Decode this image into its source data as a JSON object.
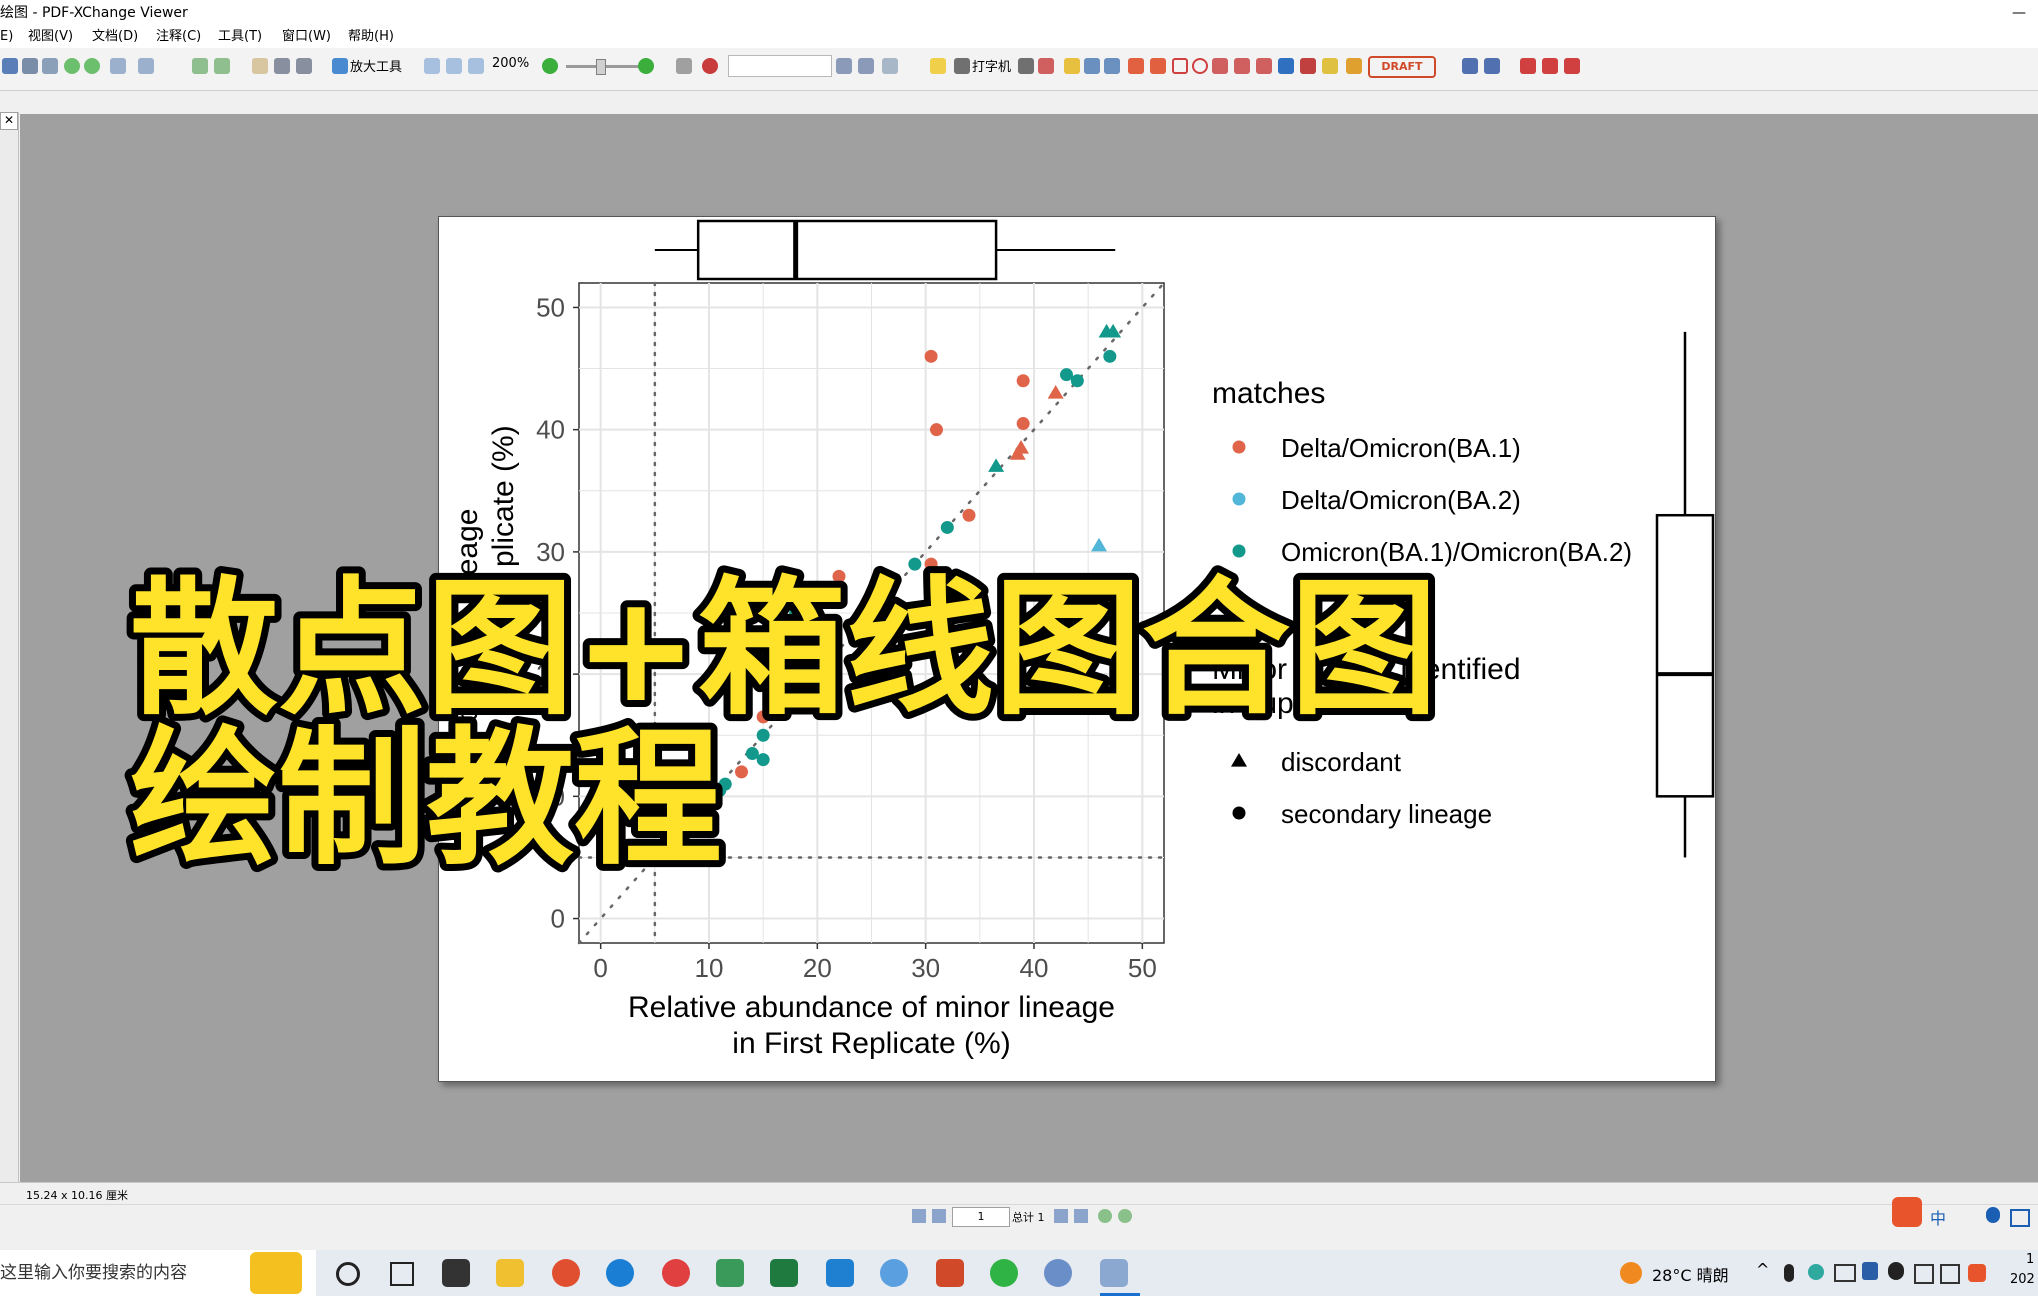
{
  "window": {
    "title": "绘图 - PDF-XChange Viewer",
    "minimize_glyph": "—"
  },
  "menu": [
    "E)",
    "视图(V)",
    "文档(D)",
    "注释(C)",
    "工具(T)",
    "窗口(W)",
    "帮助(H)"
  ],
  "toolbar": {
    "zoom_tool_label": "放大工具",
    "zoom_value": "200%",
    "typewriter_label": "打字机",
    "stamp_label": "DRAFT"
  },
  "panel": {
    "close_glyph": "✕"
  },
  "status": {
    "page_size": "15.24 x 10.16 厘米"
  },
  "nav": {
    "page_current": "1",
    "page_total": "总计 1"
  },
  "overlay": {
    "line1": "散点图+箱线图合图",
    "line2": "绘制教程"
  },
  "taskbar": {
    "search_placeholder": "这里输入你要搜索的内容",
    "weather": "28°C 晴朗",
    "ime_label": "中",
    "clock_time": "1",
    "clock_date": "202"
  },
  "chart_data": {
    "type": "scatter",
    "xlabel": "Relative abundance of minor lineage\nin First Replicate (%)",
    "ylabel": "Relative abundance of minor lineage\nin Second Replicate (%)",
    "ylabel_visible_line1": "of minor lineage",
    "ylabel_visible_line2": "plicate (%)",
    "xlim": [
      -2,
      52
    ],
    "ylim": [
      -2,
      52
    ],
    "x_ticks": [
      0,
      10,
      20,
      30,
      40,
      50
    ],
    "y_ticks": [
      0,
      10,
      20,
      30,
      40,
      50
    ],
    "threshold_x": 5,
    "threshold_y": 5,
    "identity_line": true,
    "grid": true,
    "legend_color_title": "matches",
    "legend_shape_title_line1": "Minor lineage identified",
    "legend_shape_title_line2": "in duplicates as",
    "legend_position": "right",
    "series": [
      {
        "name": "Delta/Omicron(BA.1)",
        "color": "#e0644a",
        "points": [
          {
            "x": 30.5,
            "y": 46,
            "shape": "circle"
          },
          {
            "x": 31,
            "y": 40,
            "shape": "circle"
          },
          {
            "x": 39,
            "y": 44,
            "shape": "circle"
          },
          {
            "x": 39,
            "y": 40.5,
            "shape": "circle"
          },
          {
            "x": 38.5,
            "y": 38,
            "shape": "triangle"
          },
          {
            "x": 38.8,
            "y": 38.5,
            "shape": "triangle"
          },
          {
            "x": 34,
            "y": 33,
            "shape": "circle"
          },
          {
            "x": 30.5,
            "y": 29,
            "shape": "circle"
          },
          {
            "x": 22,
            "y": 28,
            "shape": "circle"
          },
          {
            "x": 42,
            "y": 43,
            "shape": "triangle"
          },
          {
            "x": 15,
            "y": 16.5,
            "shape": "circle"
          },
          {
            "x": 13,
            "y": 12,
            "shape": "circle"
          },
          {
            "x": 10,
            "y": 12,
            "shape": "circle"
          },
          {
            "x": 40,
            "y": 20,
            "shape": "circle"
          }
        ]
      },
      {
        "name": "Delta/Omicron(BA.2)",
        "color": "#52b6d9",
        "points": [
          {
            "x": 46,
            "y": 30.5,
            "shape": "triangle"
          }
        ]
      },
      {
        "name": "Omicron(BA.1)/Omicron(BA.2)",
        "color": "#13998c",
        "points": [
          {
            "x": 46.7,
            "y": 48,
            "shape": "triangle"
          },
          {
            "x": 47.3,
            "y": 48,
            "shape": "triangle"
          },
          {
            "x": 47,
            "y": 46,
            "shape": "circle"
          },
          {
            "x": 43,
            "y": 44.5,
            "shape": "circle"
          },
          {
            "x": 44,
            "y": 44,
            "shape": "circle"
          },
          {
            "x": 36.5,
            "y": 37,
            "shape": "triangle"
          },
          {
            "x": 32,
            "y": 32,
            "shape": "circle"
          },
          {
            "x": 29,
            "y": 29,
            "shape": "circle"
          },
          {
            "x": 18,
            "y": 25,
            "shape": "circle"
          },
          {
            "x": 15,
            "y": 15,
            "shape": "circle"
          },
          {
            "x": 15,
            "y": 13,
            "shape": "circle"
          },
          {
            "x": 14,
            "y": 13.5,
            "shape": "circle"
          },
          {
            "x": 11.5,
            "y": 11,
            "shape": "circle"
          },
          {
            "x": 11,
            "y": 10.5,
            "shape": "circle"
          },
          {
            "x": 10.5,
            "y": 10,
            "shape": "circle"
          },
          {
            "x": 10,
            "y": 10,
            "shape": "circle"
          },
          {
            "x": 9.5,
            "y": 9.5,
            "shape": "circle"
          },
          {
            "x": 9,
            "y": 9,
            "shape": "circle"
          }
        ]
      }
    ],
    "shape_legend": [
      {
        "label": "discordant",
        "shape": "triangle"
      },
      {
        "label": "secondary lineage",
        "shape": "circle"
      }
    ],
    "boxplot_x": {
      "whisker_low": 5,
      "q1": 9,
      "median": 18,
      "q3": 36.5,
      "whisker_high": 47.5
    },
    "boxplot_y": {
      "whisker_low": 5,
      "q1": 10,
      "median": 20,
      "q3": 33,
      "whisker_high": 48
    }
  }
}
